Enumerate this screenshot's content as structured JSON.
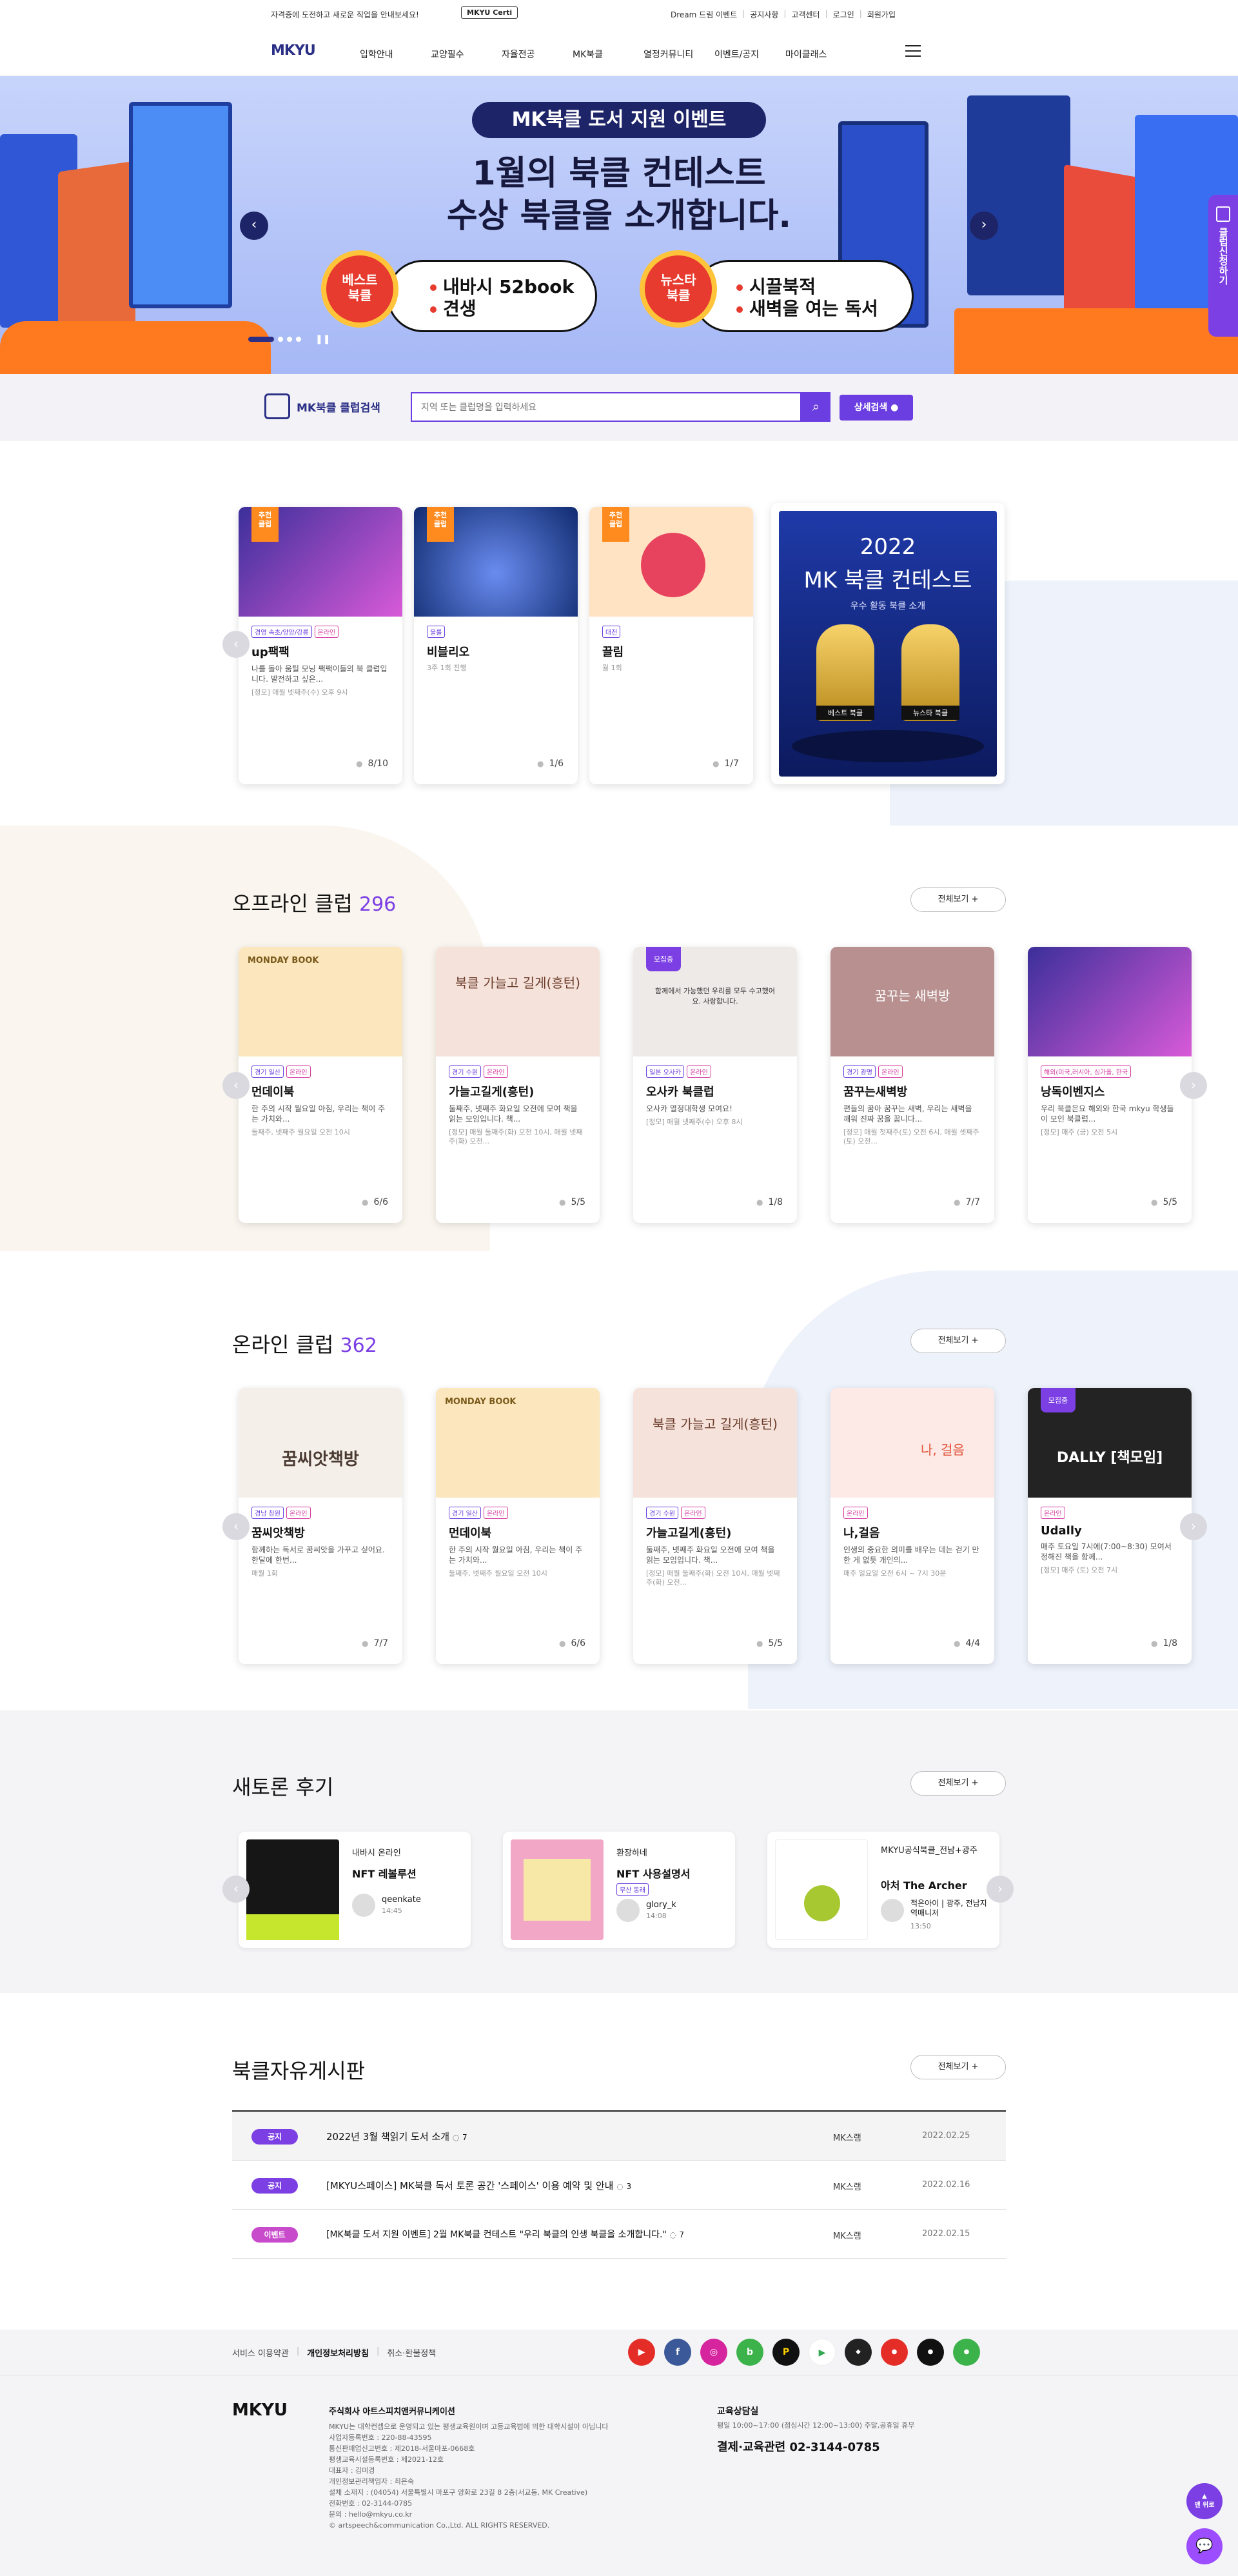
{
  "topbar": {
    "promo": "자격증에 도전하고 새로운 직업을 안내보세요!",
    "certi": "MKYU Certi",
    "util": [
      "Dream 드림 이벤트",
      "공지사항",
      "고객센터",
      "로그인",
      "회원가입"
    ]
  },
  "nav": {
    "logo": "MKYU",
    "menu": [
      "입학안내",
      "교양필수",
      "자율전공",
      "MK북클",
      "열정커뮤니티",
      "이벤트/공지",
      "마이클래스"
    ]
  },
  "hero": {
    "pill": "MK북클 도서 지원 이벤트",
    "title_1": "1월의 북클 컨테스트",
    "title_2": "수상 북클을 소개합니다.",
    "medal_a": "베스트\n북클",
    "medal_b": "뉴스타\n북클",
    "best": [
      "내바시 52book",
      "견생"
    ],
    "newstar": [
      "시끌북적",
      "새벽을 여는 독서"
    ],
    "side_button": "클럽신청하기"
  },
  "search": {
    "label": "MK북클 클럽검색",
    "placeholder": "지역 또는 클럽명을 입력하세요",
    "advanced": "상세검색"
  },
  "recommended": {
    "ribbon": "추천\n클럽",
    "cards": [
      {
        "tags": [
          "경영 속초/양양/강릉",
          "온라인"
        ],
        "name": "up팩팩",
        "desc": "나를 돌아 움틸 모닝 팩팩이들의 북 클럽입니다. 발전하고 싶은...",
        "sched": "[정모] 매월 넷째주(수) 오후 9시",
        "count": "8/10"
      },
      {
        "tags": [
          "울룰"
        ],
        "name": "비블리오",
        "desc": "",
        "sched": "3주 1회 진행",
        "count": "1/6"
      },
      {
        "tags": [
          "대전"
        ],
        "name": "끌림",
        "desc": "",
        "sched": "월 1회",
        "count": "1/7"
      }
    ],
    "contest": {
      "year": "2022",
      "title": "MK 북클 컨테스트",
      "sub": "우수 활동 북클 소개",
      "trophy_a": "베스트 북클",
      "trophy_b": "뉴스타 북클"
    }
  },
  "offline": {
    "title": "오프라인 클럽",
    "count": "296",
    "more": "전체보기",
    "cards": [
      {
        "img_text": "MONDAY BOOK",
        "tags": [
          "경기 일산",
          "온라인"
        ],
        "name": "먼데이북",
        "desc": "한 주의 시작 월요일 아침, 우리는 책이 주는 가치와...",
        "sched": "둘째주, 넷째주 월요일 오전 10시",
        "count": "6/6"
      },
      {
        "img_text": "북클 가늘고 길게(흥턴)",
        "tags": [
          "경기 수원",
          "온라인"
        ],
        "name": "가늘고길게(흥턴)",
        "desc": "둘째주, 넷째주 화요일 오전에 모여 책을 읽는 모임입니다. 책...",
        "sched": "[정모] 매월 둘째주(화) 오전 10시, 매월 넷째주(화) 오전...",
        "count": "5/5"
      },
      {
        "img_text": "함께에서 가능했던 우리를 모두 수고했어요. 사랑합니다.",
        "tags": [
          "일본 오사카",
          "온라인"
        ],
        "name": "오사카 북클럽",
        "desc": "오사카 열정대학생 모여요!",
        "sched": "[정모] 매월 넷째주(수) 오후 8시",
        "count": "1/8",
        "open": "모집중"
      },
      {
        "img_text": "꿈꾸는 새벽방",
        "tags": [
          "경기 광명",
          "온라인"
        ],
        "name": "꿈꾸는새벽방",
        "desc": "편들의 꿈아 꿈꾸는 새벽, 우리는 새벽을 깨워 진짜 꿈을 꿉니다...",
        "sched": "[정모] 매월 첫째주(토) 오전 6시, 매월 셋째주(토) 오전...",
        "count": "7/7"
      },
      {
        "img_text": "",
        "tags": [
          "해외(미국,러시아, 싱가폴, 한국"
        ],
        "name": "낭독이벤지스",
        "desc": "우리 북클은요 해외와 한국 mkyu 학생들이 모인 북클럽...",
        "sched": "[정모] 매주 (금) 오전 5시",
        "count": "5/5"
      }
    ]
  },
  "online": {
    "title": "온라인 클럽",
    "count": "362",
    "more": "전체보기",
    "cards": [
      {
        "img_text": "꿈씨앗책방",
        "tags": [
          "경남 창원",
          "온라인"
        ],
        "name": "꿈씨앗책방",
        "desc": "함께하는 독서로 꿈씨앗을 가꾸고 싶어요. 한달에 한번...",
        "sched": "매월 1회",
        "count": "7/7"
      },
      {
        "img_text": "MONDAY BOOK",
        "tags": [
          "경기 일산",
          "온라인"
        ],
        "name": "먼데이북",
        "desc": "한 주의 시작 월요일 아침, 우리는 책이 주는 가치와...",
        "sched": "둘째주, 넷째주 월요일 오전 10시",
        "count": "6/6"
      },
      {
        "img_text": "북클 가늘고 길게(흥턴)",
        "tags": [
          "경기 수원",
          "온라인"
        ],
        "name": "가늘고길게(흥턴)",
        "desc": "둘째주, 넷째주 화요일 오전에 모여 책을 읽는 모임입니다. 책...",
        "sched": "[정모] 매월 둘째주(화) 오전 10시, 매월 넷째주(화) 오전...",
        "count": "5/5"
      },
      {
        "img_text": "나, 걸음",
        "tags": [
          "온라인"
        ],
        "name": "나,걸음",
        "desc": "인생의 중요한 의미를 배우는 데는 걷기 만한 게 없듯 개인의...",
        "sched": "매주 일요일 오전 6시 ~ 7시 30분",
        "count": "4/4"
      },
      {
        "img_text": "DALLY [책모임]",
        "tags": [
          "온라인"
        ],
        "name": "Udally",
        "desc": "매주 토요일 7시에(7:00~8:30) 모여서 정해진 책을 함께...",
        "sched": "[정모] 매주 (토) 오전 7시",
        "count": "1/8",
        "open": "모집중"
      }
    ]
  },
  "reviews": {
    "title": "새토론 후기",
    "more": "전체보기",
    "items": [
      {
        "cat": "내바시 온라인",
        "title": "NFT 레볼루션",
        "user": "qeenkate",
        "time": "14:45"
      },
      {
        "cat": "환장하네",
        "title": "NFT 사용설명서",
        "tag": "무산 동래",
        "user": "glory_k",
        "time": "14:08"
      },
      {
        "cat": "MKYU공식북클_전남+광주",
        "title": "아처 The Archer",
        "user": "적은아이 | 광주, 전남지역매니저",
        "time": "13:50"
      }
    ]
  },
  "board": {
    "title": "북클자유게시판",
    "more": "전체보기",
    "rows": [
      {
        "chip": "공지",
        "title": "2022년 3월 책읽기 도서 소개",
        "comments": "7",
        "author": "MK스램",
        "date": "2022.02.25"
      },
      {
        "chip": "공지",
        "title": "[MKYU스페이스] MK북클 독서 토론 공간 '스페이스' 이용 예약 및 안내",
        "comments": "3",
        "author": "MK스램",
        "date": "2022.02.16"
      },
      {
        "chip": "이벤트",
        "title": "[MK북클 도서 지원 이벤트] 2월 MK북클 컨테스트 \"우리 북클의 인생 북클을 소개합니다.\"",
        "comments": "7",
        "author": "MK스램",
        "date": "2022.02.15"
      }
    ]
  },
  "footer": {
    "links": [
      "서비스 이용약관",
      "개인정보처리방침",
      "취소·환불정책"
    ],
    "logo": "MKYU",
    "company": "주식회사 아트스피치앤커뮤니케이션",
    "info": [
      "MKYU는 대학컨셉으로 운영되고 있는 평생교육원이며 고등교육법에 의한 대학시설이 아닙니다",
      "사업자등록번호 : 220-88-43595",
      "통신판매업신고번호 : 제2018-서울마포-0668호",
      "평생교육시설등록번호 : 제2021-12호",
      "대표자 : 김미경",
      "개인정보관리책임자 : 최은숙",
      "설체 소재지 : (04054) 서울특별시 마포구 양화로 23길 8 2층(서교동, MK Creative)",
      "전화번호 : 02-3144-0785",
      "문의 : hello@mkyu.co.kr",
      "© artspeech&communication Co.,Ltd. ALL RIGHTS RESERVED."
    ],
    "cs_title": "교육상담실",
    "cs_time": "평일 10:00~17:00 (점심시간 12:00~13:00) 주말,공휴일 휴무",
    "cs_phone": "결제·교육관련 02-3144-0785",
    "fab_top": "맨 위로"
  },
  "colors": {
    "accent": "#7b3fe4",
    "brand": "#2b2f86",
    "hero_bg": "#a6b8f6"
  }
}
